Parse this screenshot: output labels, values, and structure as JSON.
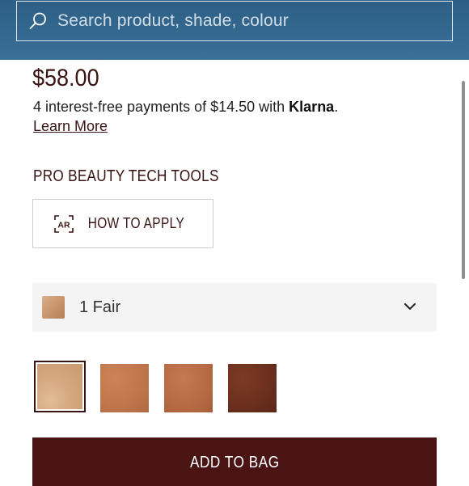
{
  "search": {
    "placeholder": "Search product, shade, colour",
    "icon": "search-icon"
  },
  "product": {
    "price": "$58.00",
    "installments_text": "4 interest-free payments of $14.50 with ",
    "installments_brand": "Klarna",
    "installments_suffix": ".",
    "learn_more": "Learn More"
  },
  "tools": {
    "heading": "PRO BEAUTY TECH TOOLS",
    "apply_button": "HOW TO APPLY",
    "apply_icon": "ar-icon",
    "apply_icon_text": "AR"
  },
  "shade_selector": {
    "selected": "1 Fair",
    "icon": "chevron-down-icon"
  },
  "swatches": [
    {
      "name": "swatch-1",
      "color": "#d3a47e",
      "selected": true
    },
    {
      "name": "swatch-2",
      "color": "#c0754b",
      "selected": false
    },
    {
      "name": "swatch-3",
      "color": "#b66a43",
      "selected": false
    },
    {
      "name": "swatch-4",
      "color": "#6b2f1d",
      "selected": false
    }
  ],
  "cta": {
    "add_to_bag": "ADD TO BAG"
  },
  "colors": {
    "header": "#33668f",
    "brand_dark": "#4a1414"
  }
}
